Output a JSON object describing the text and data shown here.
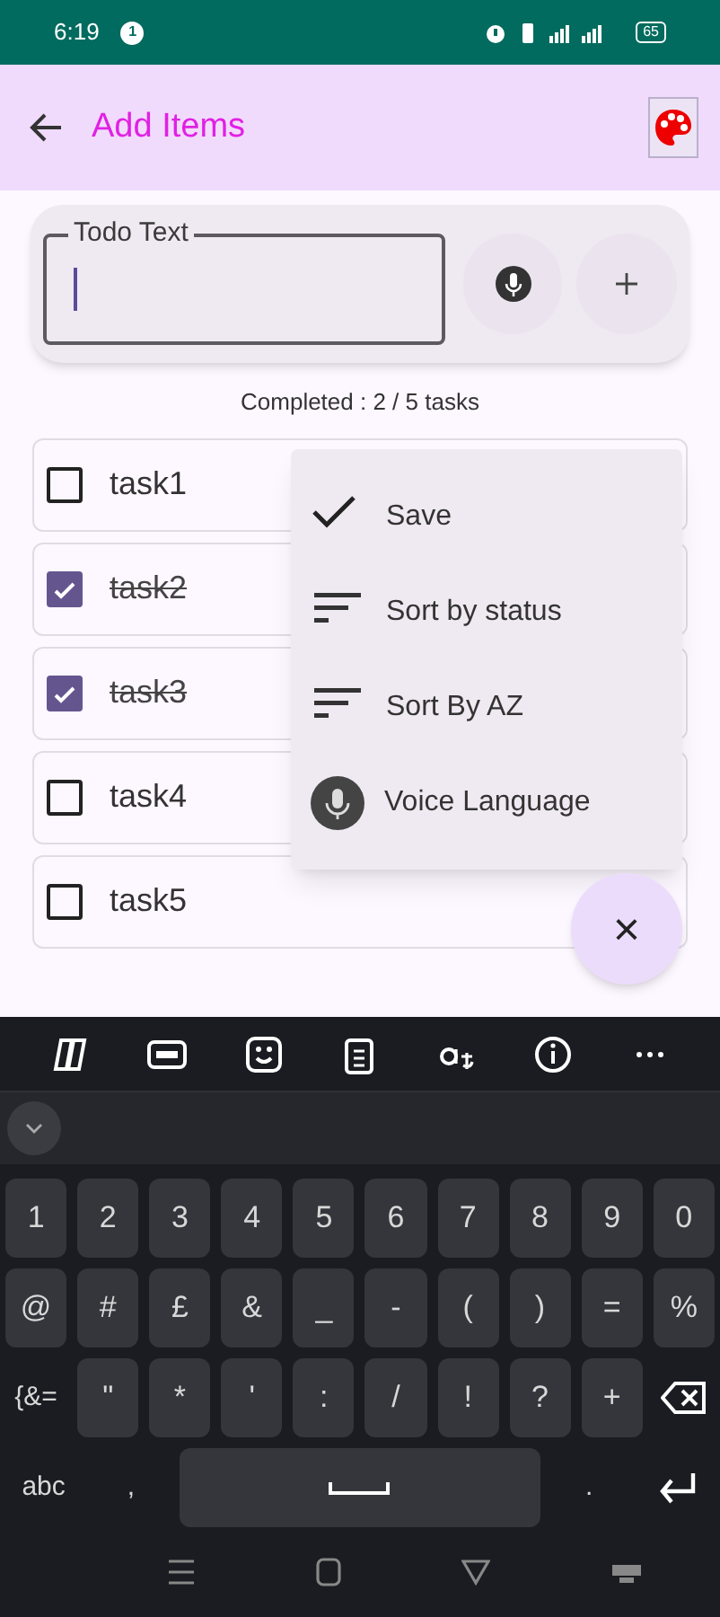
{
  "status_bar": {
    "time": "6:19",
    "notification": "1",
    "battery": "65"
  },
  "app_bar": {
    "title": "Add Items"
  },
  "input": {
    "label": "Todo Text"
  },
  "summary": "Completed : 2 / 5 tasks",
  "tasks": [
    {
      "label": "task1",
      "checked": false
    },
    {
      "label": "task2",
      "checked": true
    },
    {
      "label": "task3",
      "checked": true
    },
    {
      "label": "task4",
      "checked": false
    },
    {
      "label": "task5",
      "checked": false
    }
  ],
  "menu": [
    {
      "kind": "check",
      "label": "Save"
    },
    {
      "kind": "sort",
      "label": "Sort by status"
    },
    {
      "kind": "sort",
      "label": "Sort By AZ"
    },
    {
      "kind": "mic",
      "label": "Voice Language"
    }
  ],
  "fab": {
    "label": "×"
  },
  "keyboard": {
    "rows": [
      [
        {
          "kind": "key",
          "label": "1"
        },
        {
          "kind": "key",
          "label": "2"
        },
        {
          "kind": "key",
          "label": "3"
        },
        {
          "kind": "key",
          "label": "4"
        },
        {
          "kind": "key",
          "label": "5"
        },
        {
          "kind": "key",
          "label": "6"
        },
        {
          "kind": "key",
          "label": "7"
        },
        {
          "kind": "key",
          "label": "8"
        },
        {
          "kind": "key",
          "label": "9"
        },
        {
          "kind": "key",
          "label": "0"
        }
      ],
      [
        {
          "kind": "key",
          "label": "@"
        },
        {
          "kind": "key",
          "label": "#"
        },
        {
          "kind": "key",
          "label": "£"
        },
        {
          "kind": "key",
          "label": "&"
        },
        {
          "kind": "key",
          "label": "_"
        },
        {
          "kind": "key",
          "label": "-"
        },
        {
          "kind": "key",
          "label": "("
        },
        {
          "kind": "key",
          "label": ")"
        },
        {
          "kind": "key",
          "label": "="
        },
        {
          "kind": "key",
          "label": "%"
        }
      ],
      [
        {
          "kind": "plain",
          "label": "{&="
        },
        {
          "kind": "key",
          "label": "\""
        },
        {
          "kind": "key",
          "label": "*"
        },
        {
          "kind": "key",
          "label": "'"
        },
        {
          "kind": "key",
          "label": ":"
        },
        {
          "kind": "key",
          "label": "/"
        },
        {
          "kind": "key",
          "label": "!"
        },
        {
          "kind": "key",
          "label": "?"
        },
        {
          "kind": "key",
          "label": "+"
        },
        {
          "kind": "backspace"
        }
      ],
      [
        {
          "kind": "plain",
          "label": "abc"
        },
        {
          "kind": "plain",
          "label": ","
        },
        {
          "kind": "space"
        },
        {
          "kind": "plain",
          "label": "."
        },
        {
          "kind": "enter"
        }
      ]
    ]
  }
}
